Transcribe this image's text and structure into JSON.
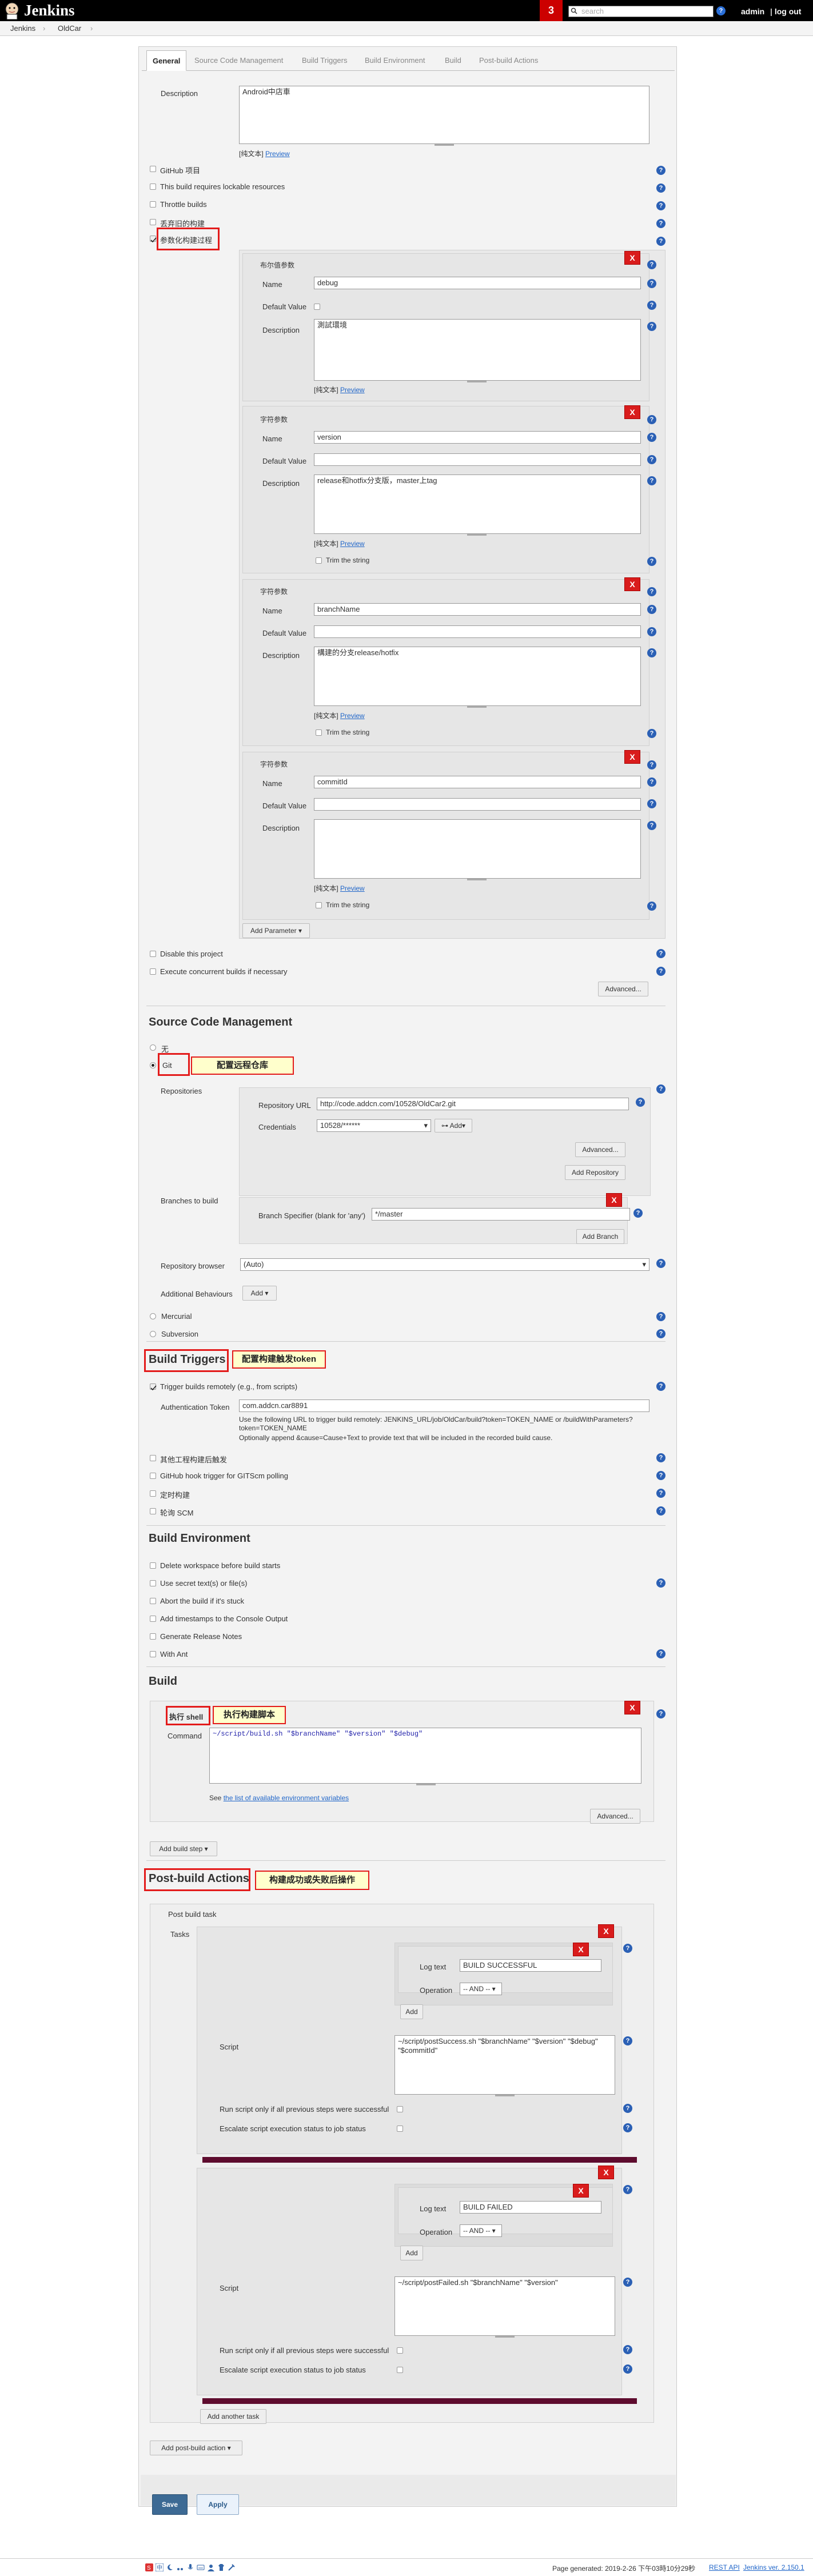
{
  "header": {
    "app_name": "Jenkins",
    "notification_count": "3",
    "search_placeholder": "search",
    "help": "?",
    "user": "admin",
    "logout": "log out"
  },
  "breadcrumb": {
    "items": [
      "Jenkins",
      "OldCar"
    ],
    "sep": "›"
  },
  "tabs": [
    "General",
    "Source Code Management",
    "Build Triggers",
    "Build Environment",
    "Build",
    "Post-build Actions"
  ],
  "general": {
    "description_label": "Description",
    "description_value": "Android中店車",
    "text_format": "[纯文本]",
    "preview": "Preview",
    "options": [
      "GitHub 项目",
      "This build requires lockable resources",
      "Throttle builds",
      "丢弃旧的构建",
      "参数化构建过程"
    ],
    "param_label_bool": "布尔值参数",
    "param_label_str": "字符参数",
    "name": "Name",
    "default_value": "Default Value",
    "description": "Description",
    "trim": "Trim the string",
    "params": [
      {
        "name": "debug",
        "desc": "測試環境"
      },
      {
        "name": "version",
        "desc": "release和hotfix分支版，master上tag"
      },
      {
        "name": "branchName",
        "desc": "構建的分支release/hotfix"
      },
      {
        "name": "commitId",
        "desc": ""
      }
    ],
    "add_parameter": "Add Parameter",
    "disable_project": "Disable this project",
    "concurrent": "Execute concurrent builds if necessary",
    "advanced": "Advanced..."
  },
  "scm": {
    "title": "Source Code Management",
    "none": "无",
    "git": "Git",
    "git_note": "配置远程仓库",
    "repositories": "Repositories",
    "repo_url_label": "Repository URL",
    "repo_url": "http://code.addcn.com/10528/OldCar2.git",
    "credentials_label": "Credentials",
    "credentials_value": "10528/******",
    "add_cred": "Add",
    "advanced": "Advanced...",
    "add_repo": "Add Repository",
    "branches_label": "Branches to build",
    "branch_spec_label": "Branch Specifier (blank for 'any')",
    "branch_spec": "*/master",
    "add_branch": "Add Branch",
    "browser_label": "Repository browser",
    "browser_value": "(Auto)",
    "behaviours_label": "Additional Behaviours",
    "add": "Add",
    "mercurial": "Mercurial",
    "subversion": "Subversion"
  },
  "triggers": {
    "title": "Build Triggers",
    "note": "配置构建触发token",
    "remote": "Trigger builds remotely (e.g., from scripts)",
    "auth_label": "Authentication Token",
    "auth_value": "com.addcn.car8891",
    "url_note": "Use the following URL to trigger build remotely: JENKINS_URL/job/OldCar/build?token=TOKEN_NAME or /buildWithParameters?token=TOKEN_NAME",
    "url_note2": "Optionally append &cause=Cause+Text to provide text that will be included in the recorded build cause.",
    "options": [
      "其他工程构建后触发",
      "GitHub hook trigger for GITScm polling",
      "定时构建",
      "轮询 SCM"
    ]
  },
  "environment": {
    "title": "Build Environment",
    "options": [
      "Delete workspace before build starts",
      "Use secret text(s) or file(s)",
      "Abort the build if it's stuck",
      "Add timestamps to the Console Output",
      "Generate Release Notes",
      "With Ant"
    ]
  },
  "build": {
    "title": "Build",
    "step_title": "执行 shell",
    "note": "执行构建脚本",
    "command_label": "Command",
    "command": "~/script/build.sh \"$branchName\" \"$version\" \"$debug\"",
    "see": "See ",
    "env_link": "the list of available environment variables",
    "advanced": "Advanced...",
    "add_step": "Add build step"
  },
  "post": {
    "title": "Post-build Actions",
    "note": "构建成功或失败后操作",
    "task_title": "Post build task",
    "tasks_label": "Tasks",
    "log_text_label": "Log text",
    "operation_label": "Operation",
    "operation_value": "-- AND --",
    "add": "Add",
    "script_label": "Script",
    "run_only": "Run script only if all previous steps were successful",
    "escalate": "Escalate script execution status to job status",
    "tasks": [
      {
        "log_text": "BUILD SUCCESSFUL",
        "script": "~/script/postSuccess.sh \"$branchName\" \"$version\" \"$debug\" \"$commitId\""
      },
      {
        "log_text": "BUILD FAILED",
        "script": "~/script/postFailed.sh \"$branchName\" \"$version\""
      }
    ],
    "add_task": "Add another task",
    "add_action": "Add post-build action"
  },
  "footer": {
    "save": "Save",
    "apply": "Apply",
    "page_generated": "Page generated: 2019-2-26 下午03時10分29秒",
    "rest_api": "REST API",
    "version": "Jenkins ver. 2.150.1"
  }
}
